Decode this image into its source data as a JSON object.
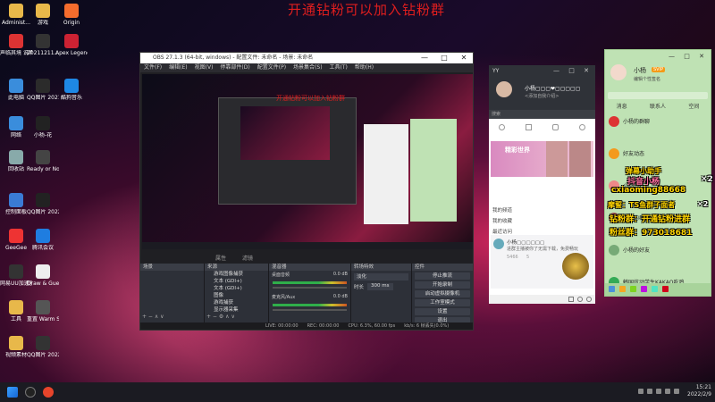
{
  "banner": "开通钻粉可以加入钻粉群",
  "desktop": {
    "icons": [
      {
        "label": "Administ...",
        "color": "#e8b84a"
      },
      {
        "label": "游戏",
        "color": "#e8b84a"
      },
      {
        "label": "Origin",
        "color": "#f56c2d"
      },
      {
        "label": "声临其境 说明.MAO...",
        "color": "#d33"
      },
      {
        "label": "20211211...",
        "color": "#333"
      },
      {
        "label": "Apex Legends",
        "color": "#c23"
      },
      {
        "label": "此电脑",
        "color": "#3a8ddc"
      },
      {
        "label": "QQ图片 2021120...",
        "color": "#2b2b2b"
      },
      {
        "label": "酷狗音乐",
        "color": "#1e88e5"
      },
      {
        "label": "网络",
        "color": "#3a8ddc"
      },
      {
        "label": "小杨-花",
        "color": "#222"
      },
      {
        "label": "回收站",
        "color": "#8aa"
      },
      {
        "label": "Ready or Not",
        "color": "#444"
      },
      {
        "label": "控制面板",
        "color": "#3a7bd5"
      },
      {
        "label": "QQ图片 2022010...",
        "color": "#222"
      },
      {
        "label": "GeeGee",
        "color": "#e33"
      },
      {
        "label": "腾讯会议",
        "color": "#1f7de0"
      },
      {
        "label": "网易UU加速器",
        "color": "#333"
      },
      {
        "label": "Draw & Guess",
        "color": "#eee"
      },
      {
        "label": "工具",
        "color": "#e8b84a"
      },
      {
        "label": "重置 Warm Snow",
        "color": "#555"
      },
      {
        "label": "视频素材",
        "color": "#e8b84a"
      },
      {
        "label": "QQ图片 2022012...",
        "color": "#333"
      }
    ]
  },
  "obs": {
    "title": "OBS 27.1.3 (64-bit, windows) - 配置文件: 未命名 - 场景: 未命名",
    "window_controls": [
      "—",
      "□",
      "✕"
    ],
    "menu": [
      "文件(F)",
      "编辑(E)",
      "视图(V)",
      "停靠部件(D)",
      "配置文件(P)",
      "场景集合(S)",
      "工具(T)",
      "帮助(H)"
    ],
    "preview_overlay": "开通钻粉可以加入钻粉群",
    "controls_bar": [
      "属性",
      "滤镜"
    ],
    "docks": {
      "scenes": {
        "header": "场景",
        "items": []
      },
      "sources": {
        "header": "来源",
        "items": [
          "游戏图像捕获",
          "文本 (GDI+)",
          "文本 (GDI+)",
          "图像",
          "游戏捕获",
          "显示器采集"
        ]
      },
      "mixer": {
        "header": "混音器",
        "channels": [
          {
            "name": "桌面音频",
            "db": "0.0 dB"
          },
          {
            "name": "麦克风/Aux",
            "db": "0.0 dB"
          }
        ]
      },
      "transitions": {
        "header": "转场特效",
        "type": "淡化",
        "duration_label": "时长",
        "duration": "300 ms"
      },
      "controls": {
        "header": "控件",
        "buttons": [
          "停止推流",
          "开始录制",
          "启动虚拟摄像机",
          "工作室模式",
          "设置",
          "退出"
        ]
      }
    },
    "status": [
      "LIVE: 00:00:00",
      "REC: 00:00:00",
      "CPU: 6.3%, 60.00 fps",
      "kb/s: 6 帧丢失(0.0%)"
    ]
  },
  "yy": {
    "title": "YY",
    "window_controls": [
      "—",
      "□",
      "✕"
    ],
    "name": "小杨▢▢▢❤▢▢▢▢▢",
    "sign": "<添加自我介绍>",
    "search": "搜索",
    "banner": "精彩世界",
    "list": [
      "我的频道",
      "我的收藏",
      "最近访问"
    ],
    "chat_name": "小杨▢▢▢▢▢▢",
    "chat_text": "进群主播被你了无需下载，免费畅玩",
    "chat_stats": [
      "5466",
      "5"
    ]
  },
  "qq": {
    "window_controls": [
      "—",
      "□",
      "✕"
    ],
    "nick": "小杨",
    "vip": "SVIP",
    "sub": "编辑个性签名",
    "tabs": [
      "消息",
      "联系人",
      "空间"
    ],
    "rows": [
      {
        "title": "小杨的群聊",
        "sub": "",
        "color": "#d33"
      },
      {
        "title": "好友动态",
        "sub": "",
        "color": "#f39a1e"
      },
      {
        "title": "小杨的好友",
        "sub": "",
        "color": "#e88"
      },
      {
        "title": "小杨的群",
        "sub": "",
        "color": "#a55"
      },
      {
        "title": "小杨的好友",
        "sub": "",
        "color": "#7a7"
      },
      {
        "title": "韩国炫动学生KAKAO吃鸡",
        "sub": "",
        "color": "#3a5"
      }
    ]
  },
  "overlays": [
    {
      "text": "弹幕小助手",
      "color": "#ffd400",
      "size": 8
    },
    {
      "text": "抖音小杨",
      "color": "#ff6ea0",
      "size": 9
    },
    {
      "text": "✕2",
      "color": "#ffffff",
      "size": 9
    },
    {
      "text": "cxiaoming88668",
      "color": "#ffd400",
      "size": 9
    },
    {
      "text": "摩誓：TS鱼群子面者",
      "color": "#ffd400",
      "size": 8
    },
    {
      "text": "✕2",
      "color": "#ffffff",
      "size": 8
    },
    {
      "text": "钻粉群：开通钻粉进群",
      "color": "#ffd400",
      "size": 9
    },
    {
      "text": "粉丝群：973018681",
      "color": "#ffd400",
      "size": 9
    }
  ],
  "taskbar": {
    "time": "15:21",
    "date": "2022/2/9"
  }
}
